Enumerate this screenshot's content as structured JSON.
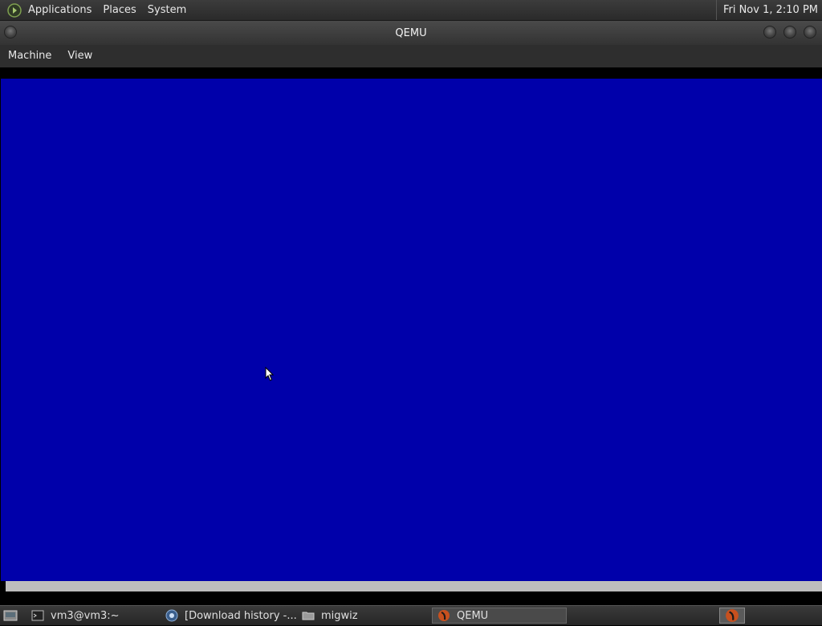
{
  "top_panel": {
    "menu": [
      "Applications",
      "Places",
      "System"
    ],
    "clock": "Fri Nov  1,  2:10 PM"
  },
  "window": {
    "title": "QEMU",
    "menu": [
      "Machine",
      "View"
    ]
  },
  "vm": {
    "background_color": "#0000aa"
  },
  "taskbar": {
    "tasks": [
      {
        "label": "vm3@vm3:~",
        "icon": "terminal-icon"
      },
      {
        "label": "[Download history -...",
        "icon": "browser-icon"
      },
      {
        "label": "migwiz",
        "icon": "folder-icon"
      },
      {
        "label": "QEMU",
        "icon": "qemu-icon",
        "active": true
      }
    ]
  }
}
